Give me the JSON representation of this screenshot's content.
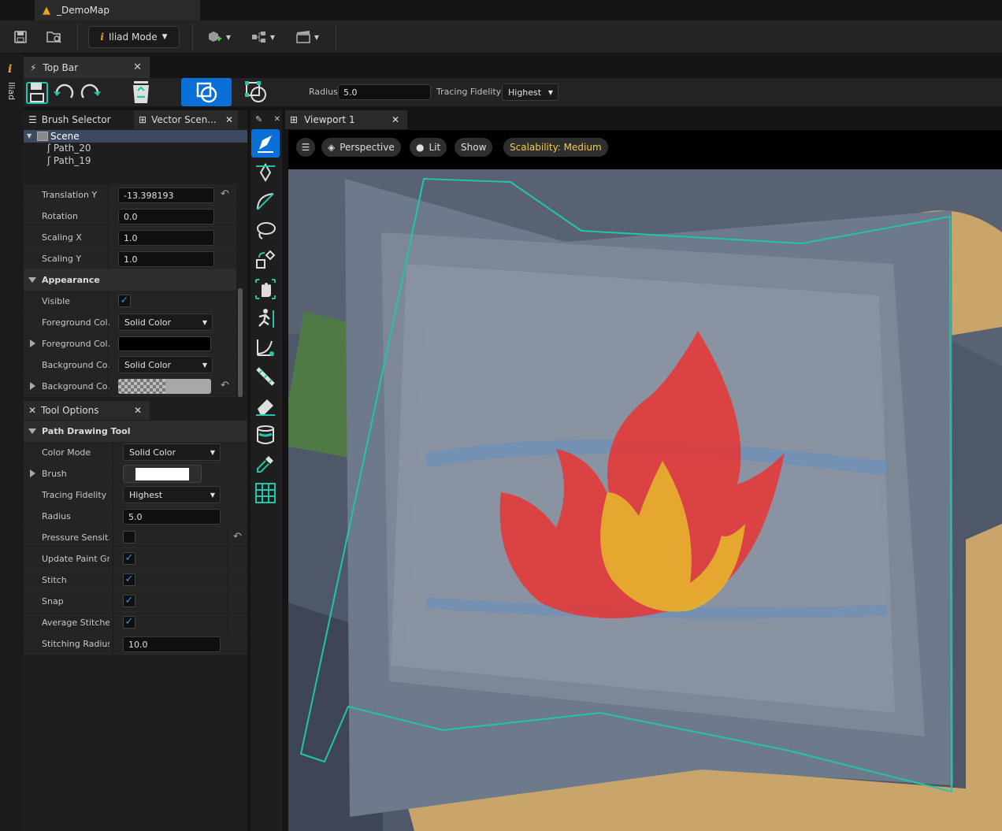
{
  "window": {
    "document_title": "_DemoMap"
  },
  "toolbar": {
    "mode_label": "Iliad Mode",
    "mode_icon": "info-icon"
  },
  "side_strip": {
    "label": "Iliad"
  },
  "topbar_panel": {
    "tab_label": "Top Bar",
    "radius_label": "Radius",
    "radius_value": "5.0",
    "tracing_fidelity_label": "Tracing Fidelity",
    "tracing_fidelity_value": "Highest"
  },
  "left_tabs": {
    "brush_selector": "Brush Selector",
    "vector_scene": "Vector Scen..."
  },
  "scene_tree": {
    "root": "Scene",
    "items": [
      "Path_20",
      "Path_19"
    ]
  },
  "details": {
    "translation_y": {
      "label": "Translation Y",
      "value": "-13.398193"
    },
    "rotation": {
      "label": "Rotation",
      "value": "0.0"
    },
    "scaling_x": {
      "label": "Scaling X",
      "value": "1.0"
    },
    "scaling_y": {
      "label": "Scaling Y",
      "value": "1.0"
    },
    "appearance": "Appearance",
    "visible": {
      "label": "Visible",
      "checked": true
    },
    "foreground_mode": {
      "label": "Foreground Col...",
      "value": "Solid Color"
    },
    "foreground_color": {
      "label": "Foreground Col...",
      "color": "#000000"
    },
    "background_mode": {
      "label": "Background Co...",
      "value": "Solid Color"
    },
    "background_color": {
      "label": "Background Co..."
    }
  },
  "tool_options": {
    "tab_label": "Tool Options",
    "category": "Path Drawing Tool",
    "color_mode": {
      "label": "Color Mode",
      "value": "Solid Color"
    },
    "brush": {
      "label": "Brush",
      "color": "#ffffff"
    },
    "tracing_fidelity": {
      "label": "Tracing Fidelity",
      "value": "Highest"
    },
    "radius": {
      "label": "Radius",
      "value": "5.0"
    },
    "pressure": {
      "label": "Pressure Sensit...",
      "checked": false
    },
    "update_paint": {
      "label": "Update Paint Gr...",
      "checked": true
    },
    "stitch": {
      "label": "Stitch",
      "checked": true
    },
    "snap": {
      "label": "Snap",
      "checked": true
    },
    "average_stitches": {
      "label": "Average Stitche...",
      "checked": true
    },
    "stitching_radius": {
      "label": "Stitching Radius",
      "value": "10.0"
    }
  },
  "viewport": {
    "tab_label": "Viewport 1",
    "perspective": "Perspective",
    "lit": "Lit",
    "show": "Show",
    "scalability": "Scalability: Medium"
  },
  "colors": {
    "accent_blue": "#0a6fd6",
    "teal": "#21c5a8",
    "scalability_text": "#f2c94c",
    "flame_red": "#e23a3a",
    "flame_yellow": "#e6b32e"
  }
}
